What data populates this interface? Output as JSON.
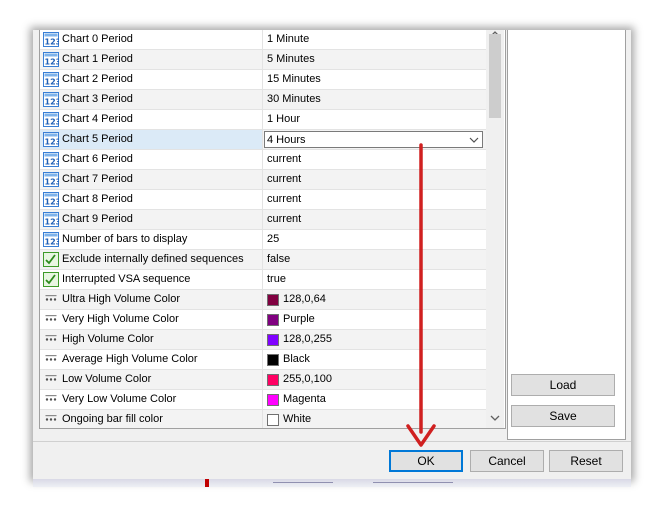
{
  "rows": [
    {
      "name": "Chart 0 Period",
      "value": "1 Minute",
      "icon": "number-123-icon"
    },
    {
      "name": "Chart 1 Period",
      "value": "5 Minutes",
      "icon": "number-123-icon"
    },
    {
      "name": "Chart 2 Period",
      "value": "15 Minutes",
      "icon": "number-123-icon"
    },
    {
      "name": "Chart 3 Period",
      "value": "30 Minutes",
      "icon": "number-123-icon"
    },
    {
      "name": "Chart 4 Period",
      "value": "1 Hour",
      "icon": "number-123-icon"
    },
    {
      "name": "Chart 5 Period",
      "value": "4 Hours",
      "icon": "number-123-icon",
      "selected": true,
      "dropdown": true
    },
    {
      "name": "Chart 6 Period",
      "value": "current",
      "icon": "number-123-icon"
    },
    {
      "name": "Chart 7 Period",
      "value": "current",
      "icon": "number-123-icon"
    },
    {
      "name": "Chart 8 Period",
      "value": "current",
      "icon": "number-123-icon"
    },
    {
      "name": "Chart 9 Period",
      "value": "current",
      "icon": "number-123-icon"
    },
    {
      "name": "Number of bars to display",
      "value": "25",
      "icon": "number-123-icon"
    },
    {
      "name": "Exclude internally defined sequences",
      "value": "false",
      "icon": "boolean-toggle-icon"
    },
    {
      "name": "Interrupted VSA sequence",
      "value": "true",
      "icon": "boolean-toggle-icon"
    },
    {
      "name": "Ultra High Volume Color",
      "value": "128,0,64",
      "icon": "color-dots-icon",
      "color": "#800040"
    },
    {
      "name": "Very High Volume Color",
      "value": "Purple",
      "icon": "color-dots-icon",
      "color": "#800080"
    },
    {
      "name": "High Volume Color",
      "value": "128,0,255",
      "icon": "color-dots-icon",
      "color": "#8000ff"
    },
    {
      "name": "Average High Volume Color",
      "value": "Black",
      "icon": "color-dots-icon",
      "color": "#000000"
    },
    {
      "name": "Low Volume Color",
      "value": "255,0,100",
      "icon": "color-dots-icon",
      "color": "#ff0064"
    },
    {
      "name": "Very Low Volume Color",
      "value": "Magenta",
      "icon": "color-dots-icon",
      "color": "#ff00ff"
    },
    {
      "name": "Ongoing bar fill color",
      "value": "White",
      "icon": "color-dots-icon",
      "color": "#ffffff"
    }
  ],
  "buttons": {
    "load": "Load",
    "save": "Save",
    "ok": "OK",
    "cancel": "Cancel",
    "reset": "Reset"
  },
  "colors": {
    "annotation_arrow": "#d02020",
    "accent": "#0078d7"
  }
}
